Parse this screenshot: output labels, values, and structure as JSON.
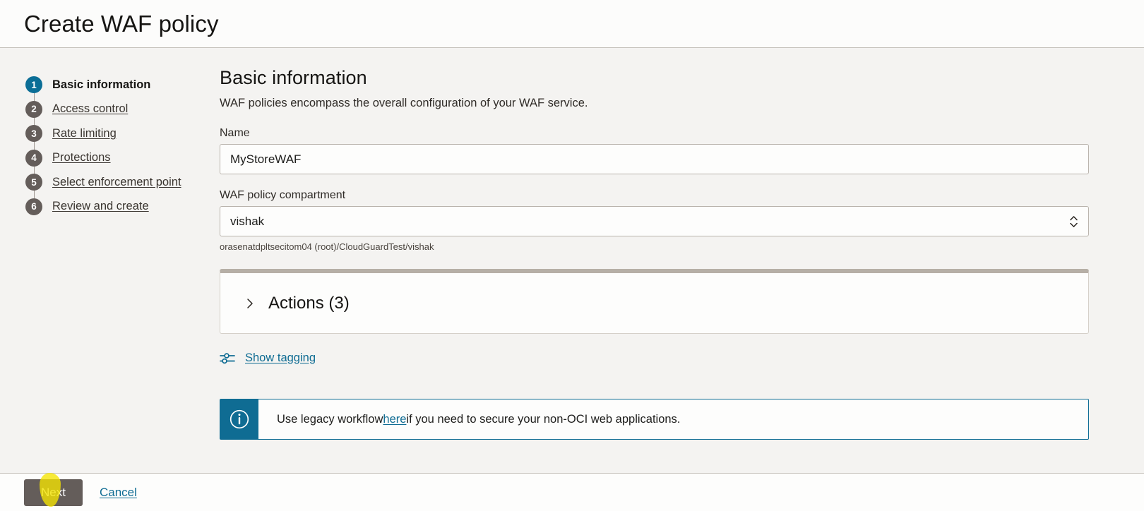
{
  "header": {
    "title": "Create WAF policy"
  },
  "wizard": {
    "steps": [
      {
        "num": "1",
        "label": "Basic information"
      },
      {
        "num": "2",
        "label": "Access control"
      },
      {
        "num": "3",
        "label": "Rate limiting"
      },
      {
        "num": "4",
        "label": "Protections"
      },
      {
        "num": "5",
        "label": "Select enforcement point"
      },
      {
        "num": "6",
        "label": "Review and create"
      }
    ]
  },
  "main": {
    "section_title": "Basic information",
    "section_desc": "WAF policies encompass the overall configuration of your WAF service.",
    "name_field": {
      "label": "Name",
      "value": "MyStoreWAF"
    },
    "compartment_field": {
      "label": "WAF policy compartment",
      "value": "vishak",
      "help_path": "orasenatdpltsecitom04 (root)/CloudGuardTest/vishak"
    },
    "actions_panel": {
      "title": "Actions (3)"
    },
    "tagging": {
      "label": "Show tagging"
    },
    "banner": {
      "text_before": "Use legacy workflow ",
      "link": "here",
      "text_after": " if you need to secure your non-OCI web applications."
    }
  },
  "footer": {
    "next_label": "Next",
    "cancel_label": "Cancel"
  },
  "colors": {
    "accent": "#0f6c93",
    "active_step": "#0b6e96",
    "button": "#645d5a",
    "highlight": "#f5e400",
    "background": "#f4f3f1"
  }
}
